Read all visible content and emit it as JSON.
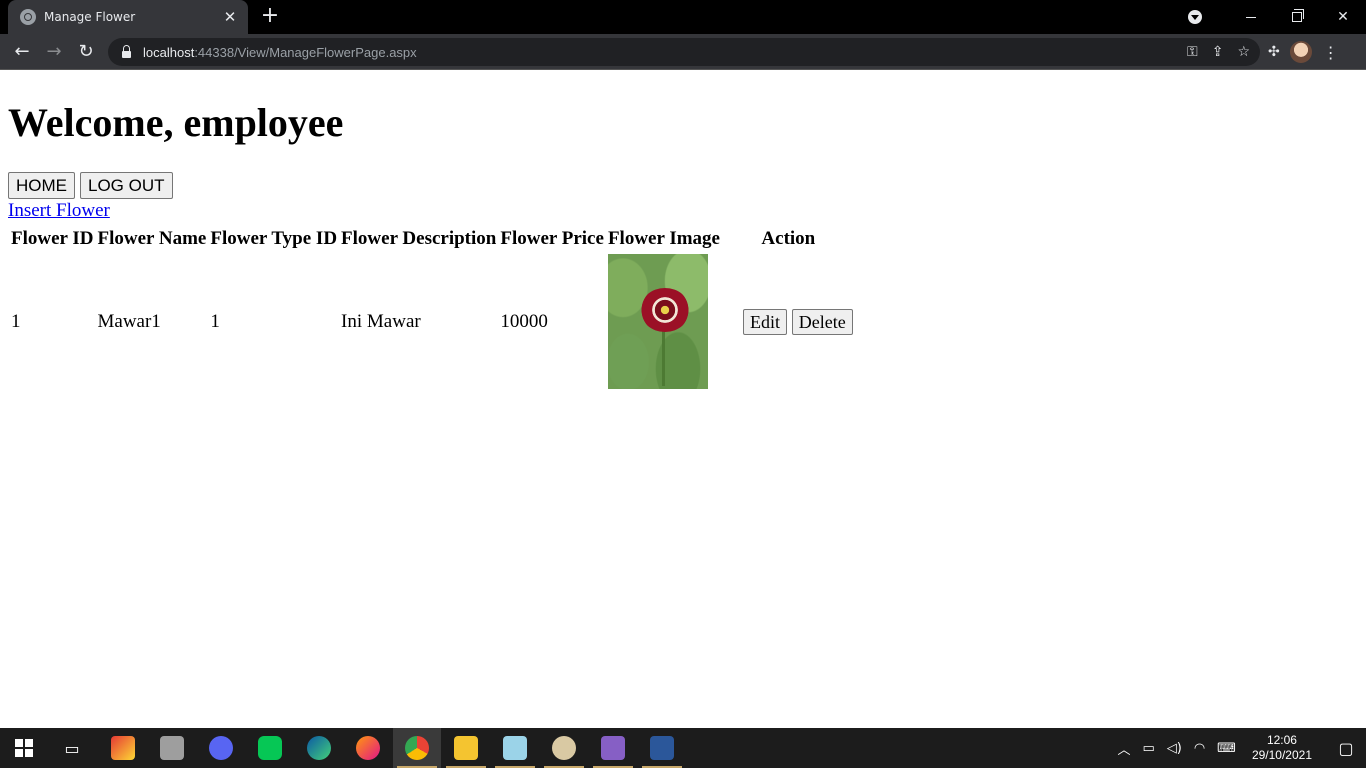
{
  "browser": {
    "tab_title": "Manage Flower",
    "tab_close": "✕",
    "new_tab": "+",
    "url_host": "localhost",
    "url_rest": ":44338/View/ManageFlowerPage.aspx",
    "nav": {
      "back": "←",
      "forward": "→",
      "reload": "↻"
    },
    "omnibox_icons": [
      "key-icon",
      "share-icon",
      "star-icon"
    ],
    "window_controls": {
      "close": "✕"
    }
  },
  "page": {
    "heading": "Welcome, employee",
    "buttons": {
      "home": "HOME",
      "logout": "LOG OUT"
    },
    "insert_link": "Insert Flower",
    "table": {
      "headers": [
        "Flower ID",
        "Flower Name",
        "Flower Type ID",
        "Flower Description",
        "Flower Price",
        "Flower Image",
        "Action"
      ],
      "rows": [
        {
          "id": "1",
          "name": "Mawar1",
          "type_id": "1",
          "description": "Ini Mawar",
          "price": "10000",
          "image": "red-zinnia-flower-image",
          "edit": "Edit",
          "delete": "Delete"
        }
      ]
    }
  },
  "taskbar": {
    "apps": [
      "start-icon",
      "task-view-icon",
      "app-icon",
      "photos-icon",
      "discord-icon",
      "line-icon",
      "edge-icon",
      "firefox-icon",
      "chrome-icon",
      "file-explorer-icon",
      "app-icon-2",
      "paint-icon",
      "visual-studio-icon",
      "word-icon"
    ],
    "time": "12:06",
    "date": "29/10/2021"
  },
  "colors": {
    "link": "#0000ee",
    "browser_dark": "#35363a",
    "taskbar": "#1c1c1c"
  }
}
